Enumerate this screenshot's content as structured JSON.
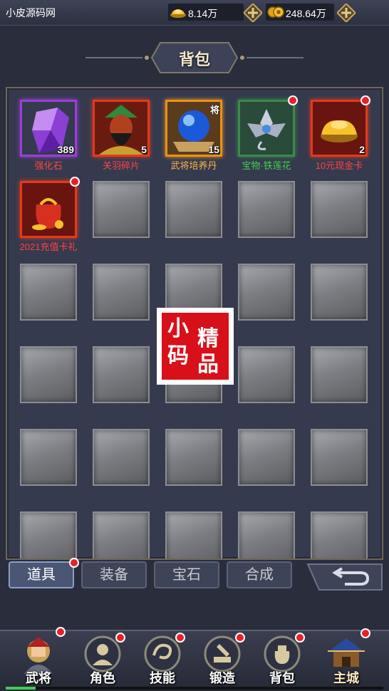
{
  "topbar": {
    "site_name": "小皮源码网",
    "gold_value": "8.14万",
    "coin_value": "248.64万",
    "gold_icon": "gold-ingot-icon",
    "coin_icon": "coin-icon",
    "plus_icon": "plus-icon"
  },
  "title": "背包",
  "items": [
    {
      "name": "强化石",
      "count": "389",
      "icon": "purple-gem-icon",
      "name_color": "#ff4444",
      "frame_color": "#9b3fd6",
      "badge": false,
      "dot": false
    },
    {
      "name": "关羽碎片",
      "count": "5",
      "icon": "guanyu-portrait-icon",
      "name_color": "#ff4444",
      "frame_color": "#e23a1a",
      "badge": false,
      "dot": false
    },
    {
      "name": "武将培养丹",
      "count": "15",
      "icon": "blue-orb-icon",
      "name_color": "#ffb44a",
      "frame_color": "#e8921a",
      "badge": true,
      "badge_text": "将",
      "dot": false
    },
    {
      "name": "宝物·铁莲花",
      "count": "",
      "icon": "iron-lotus-icon",
      "name_color": "#3ed14a",
      "frame_color": "#3c8a4a",
      "badge": false,
      "dot": true
    },
    {
      "name": "10元现金卡",
      "count": "2",
      "icon": "gold-ingot-card-icon",
      "name_color": "#ff4444",
      "frame_color": "#e23a1a",
      "badge": false,
      "dot": true
    },
    {
      "name": "2021充值卡礼",
      "count": "",
      "icon": "gift-bag-icon",
      "name_color": "#ff4444",
      "frame_color": "#e23a1a",
      "badge": false,
      "dot": true
    }
  ],
  "empty_slots": 24,
  "tabs": [
    {
      "label": "道具",
      "active": true,
      "dot": true
    },
    {
      "label": "装备",
      "active": false,
      "dot": false
    },
    {
      "label": "宝石",
      "active": false,
      "dot": false
    },
    {
      "label": "合成",
      "active": false,
      "dot": false
    }
  ],
  "back_icon": "back-arrow-icon",
  "nav": [
    {
      "label": "武将",
      "icon": "general-icon",
      "dot": true
    },
    {
      "label": "角色",
      "icon": "role-icon",
      "dot": true
    },
    {
      "label": "技能",
      "icon": "skill-icon",
      "dot": true
    },
    {
      "label": "锻造",
      "icon": "forge-icon",
      "dot": true
    },
    {
      "label": "背包",
      "icon": "bag-icon",
      "dot": true
    },
    {
      "label": "主城",
      "icon": "main-city-icon",
      "dot": true
    }
  ],
  "progress_fraction": 0.08,
  "stamp": {
    "chars": [
      "小",
      "精",
      "码",
      "品"
    ]
  },
  "colors": {
    "panel_bg": "#353a4e",
    "red_dot": "#e8202a",
    "stamp_red": "#d8101a"
  }
}
